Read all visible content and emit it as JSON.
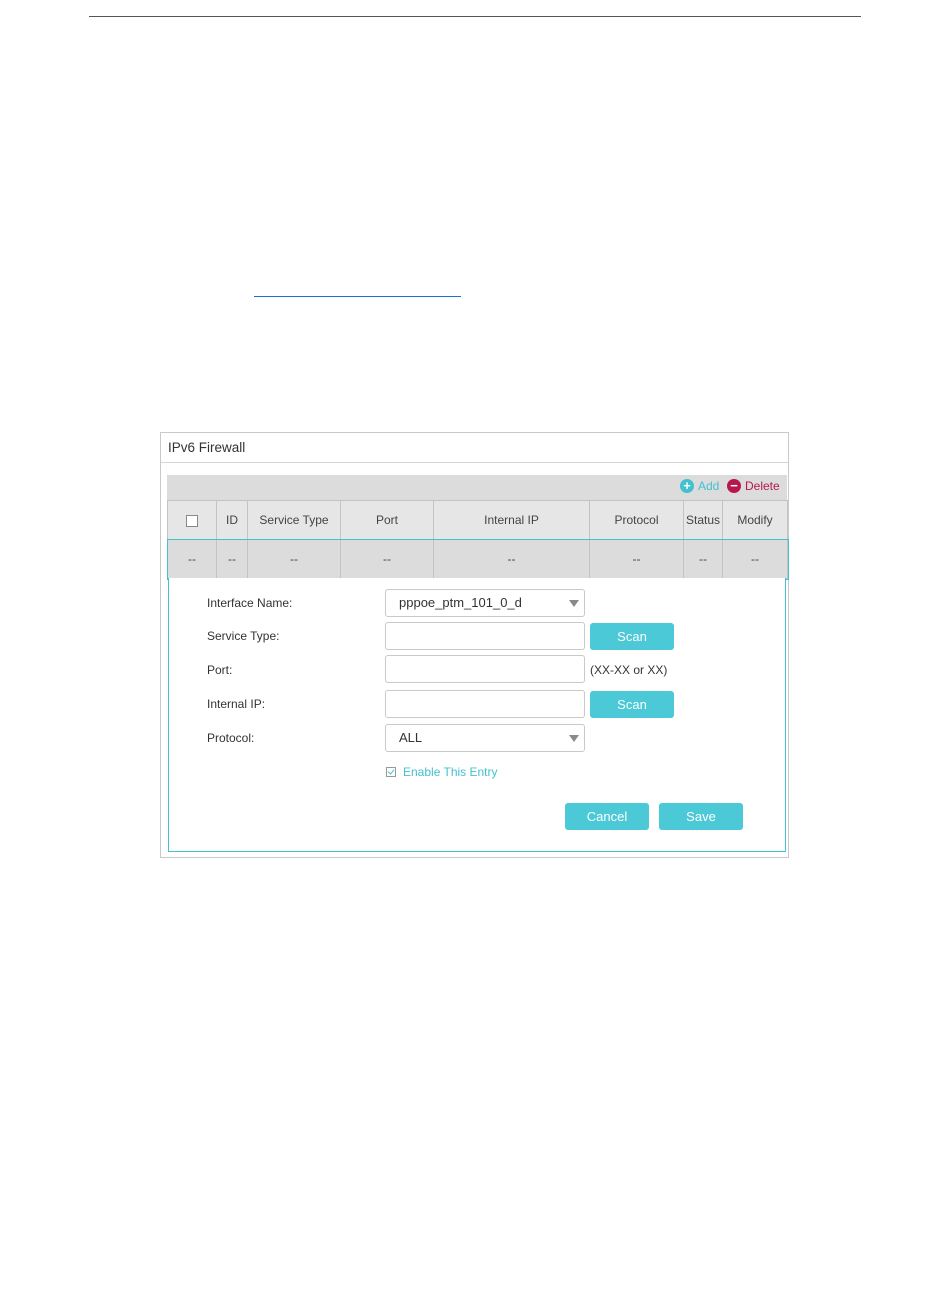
{
  "panel": {
    "title": "IPv6 Firewall"
  },
  "toolbar": {
    "add_label": "Add",
    "delete_label": "Delete",
    "add_symbol": "+",
    "delete_symbol": "−"
  },
  "table": {
    "headers": [
      "ID",
      "Service Type",
      "Port",
      "Internal IP",
      "Protocol",
      "Status",
      "Modify"
    ],
    "rows": [
      [
        "--",
        "--",
        "--",
        "--",
        "--",
        "--",
        "--",
        "--"
      ]
    ]
  },
  "form": {
    "interface_label": "Interface Name:",
    "interface_value": "pppoe_ptm_101_0_d",
    "service_type_label": "Service Type:",
    "service_type_value": "",
    "port_label": "Port:",
    "port_value": "",
    "port_hint": "(XX-XX or XX)",
    "internal_ip_label": "Internal IP:",
    "internal_ip_value": "",
    "protocol_label": "Protocol:",
    "protocol_value": "ALL",
    "scan_label": "Scan",
    "enable_label": "Enable This Entry",
    "enable_checked": true,
    "cancel_label": "Cancel",
    "save_label": "Save"
  },
  "colors": {
    "accent": "#4cc9d7",
    "delete": "#b6174f",
    "link": "#1b6fd1"
  }
}
